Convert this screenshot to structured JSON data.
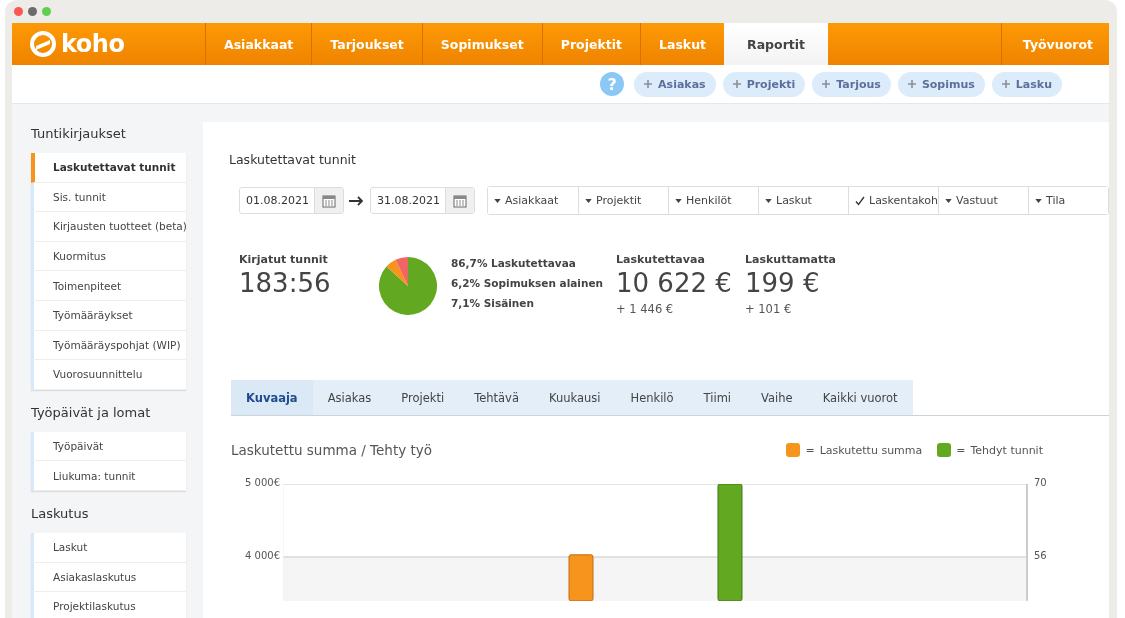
{
  "app": {
    "logo": "koho"
  },
  "nav": [
    {
      "label": "Asiakkaat",
      "selected": false
    },
    {
      "label": "Tarjoukset",
      "selected": false
    },
    {
      "label": "Sopimukset",
      "selected": false
    },
    {
      "label": "Projektit",
      "selected": false
    },
    {
      "label": "Laskut",
      "selected": false
    },
    {
      "label": "Raportit",
      "selected": true
    }
  ],
  "nav_right": {
    "label": "Työvuorot",
    "selected": false
  },
  "help": {
    "label": "?"
  },
  "quick_add": [
    "Asiakas",
    "Projekti",
    "Tarjous",
    "Sopimus",
    "Lasku"
  ],
  "sidebar": [
    {
      "heading": "Tuntikirjaukset",
      "items": [
        {
          "label": "Laskutettavat tunnit",
          "selected": true
        },
        {
          "label": "Sis. tunnit",
          "selected": false
        },
        {
          "label": "Kirjausten tuotteet (beta)",
          "selected": false
        },
        {
          "label": "Kuormitus",
          "selected": false
        },
        {
          "label": "Toimenpiteet",
          "selected": false
        },
        {
          "label": "Työmääräykset",
          "selected": false
        },
        {
          "label": "Työmääräyspohjat (WIP)",
          "selected": false
        },
        {
          "label": "Vuorosuunnittelu",
          "selected": false
        }
      ]
    },
    {
      "heading": "Työpäivät ja lomat",
      "items": [
        {
          "label": "Työpäivät",
          "selected": false
        },
        {
          "label": "Liukuma: tunnit",
          "selected": false
        }
      ]
    },
    {
      "heading": "Laskutus",
      "items": [
        {
          "label": "Laskut",
          "selected": false
        },
        {
          "label": "Asiakaslaskutus",
          "selected": false
        },
        {
          "label": "Projektilaskutus",
          "selected": false
        }
      ]
    }
  ],
  "main": {
    "title": "Laskutettavat tunnit",
    "date_from": "01.08.2021",
    "date_to": "31.08.2021",
    "filters": [
      {
        "label": "Asiakkaat",
        "checked": false
      },
      {
        "label": "Projektit",
        "checked": false
      },
      {
        "label": "Henkilöt",
        "checked": false
      },
      {
        "label": "Laskut",
        "checked": false
      },
      {
        "label": "Laskentakoh",
        "checked": true
      },
      {
        "label": "Vastuut",
        "checked": false
      },
      {
        "label": "Tila",
        "checked": false
      }
    ],
    "hours": {
      "label": "Kirjatut tunnit",
      "value": "183:56"
    },
    "split": {
      "chart_data": {
        "type": "pie",
        "values": [
          86.7,
          6.2,
          7.1
        ],
        "colors": [
          "#63a821",
          "#f7941d",
          "#f26565"
        ]
      },
      "legend": [
        "86,7% Laskutettavaa",
        "6,2% Sopimuksen alainen",
        "7,1% Sisäinen"
      ]
    },
    "totals": [
      {
        "label": "Laskutettavaa",
        "value": "10 622 €",
        "change": "+ 1 446 €"
      },
      {
        "label": "Laskuttamatta",
        "value": "199 €",
        "change": "+ 101 €"
      }
    ],
    "tabs": [
      {
        "label": "Kuvaaja",
        "selected": true
      },
      {
        "label": "Asiakas",
        "selected": false
      },
      {
        "label": "Projekti",
        "selected": false
      },
      {
        "label": "Tehtävä",
        "selected": false
      },
      {
        "label": "Kuukausi",
        "selected": false
      },
      {
        "label": "Henkilö",
        "selected": false
      },
      {
        "label": "Tiimi",
        "selected": false
      },
      {
        "label": "Vaihe",
        "selected": false
      },
      {
        "label": "Kaikki vuorot",
        "selected": false
      }
    ],
    "chart": {
      "legend_sep": "=",
      "chart_data": {
        "type": "bar",
        "title": "Laskutettu summa / Tehty työ",
        "ylim": [
          3400,
          5000
        ],
        "yticks": [
          {
            "value": 4000,
            "label": "4 000€"
          },
          {
            "value": 5000,
            "label": "5 000€"
          }
        ],
        "y2lim": [
          47.6,
          70
        ],
        "y2ticks": [
          56,
          70
        ],
        "series": [
          {
            "name": "Laskutettu summa",
            "color": "#f7941d",
            "values": [
              4030,
              null
            ]
          },
          {
            "name": "Tehdyt tunnit",
            "color": "#63a821",
            "axis": "y2",
            "values": [
              null,
              70
            ]
          }
        ]
      }
    }
  }
}
